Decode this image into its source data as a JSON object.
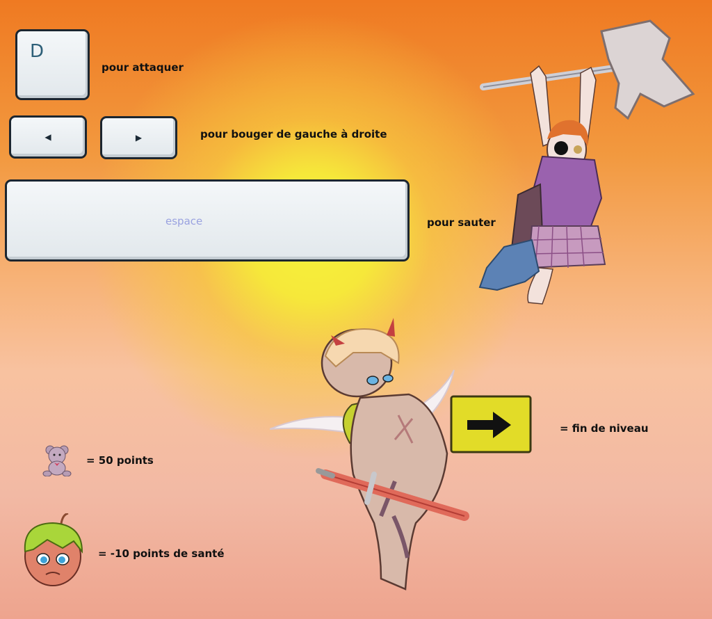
{
  "keys": {
    "attack_key": "D",
    "left_key_icon": "left-arrow-icon",
    "right_key_icon": "right-arrow-icon",
    "space_key": "espace"
  },
  "labels": {
    "attack": "pour attaquer",
    "move": "pour bouger de gauche à droite",
    "jump": "pour sauter",
    "level_end": "= fin de niveau",
    "teddy_points": "= 50 points",
    "health": "= -10 points de santé"
  },
  "glyphs": {
    "left": "◀",
    "right": "▶"
  },
  "colors": {
    "key_text": "#2d5f78",
    "space_text": "#9aa2e0",
    "sign": "#e2dc28"
  }
}
